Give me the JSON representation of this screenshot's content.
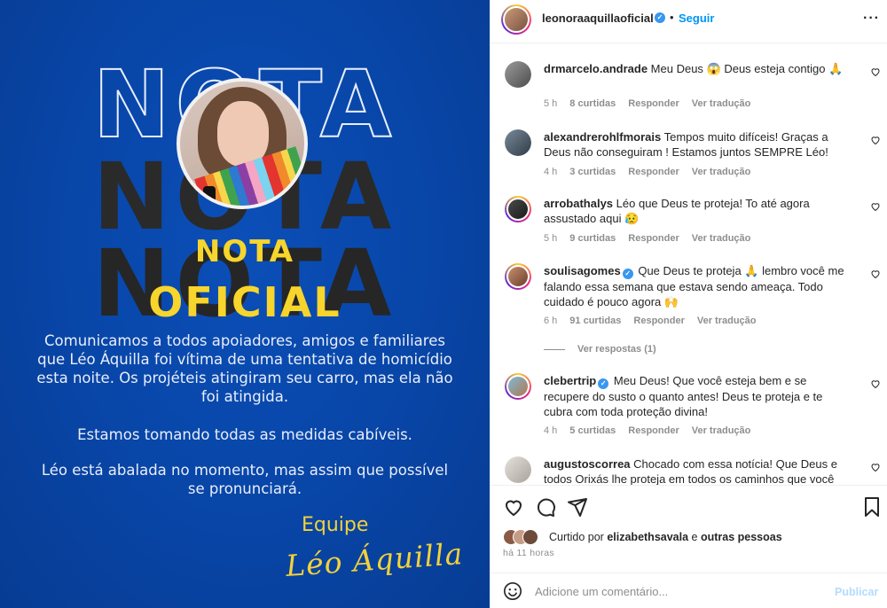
{
  "post_image": {
    "bg_word": "NOTA",
    "title_line1": "NOTA",
    "title_line2": "OFICIAL",
    "statement_1": "Comunicamos a todos apoiadores, amigos e familiares que Léo Áquilla foi vítima de uma tentativa de homicídio esta noite. Os projéteis atingiram seu carro, mas ela não foi atingida.",
    "statement_2": "Estamos tomando todas as medidas cabíveis.",
    "statement_3": "Léo está abalada no momento, mas assim que possível se pronunciará.",
    "team_label": "Equipe",
    "signature": "Léo Áquilla"
  },
  "header": {
    "username": "leonoraaquillaoficial",
    "separator": "•",
    "follow_label": "Seguir",
    "more_label": "···"
  },
  "comments": [
    {
      "user": "drmarcelo.andrade",
      "text": "Meu Deus 😱 Deus esteja contigo 🙏",
      "time": "5 h",
      "likes": "8 curtidas",
      "reply": "Responder",
      "translate": "Ver tradução",
      "verified": false
    },
    {
      "user": "alexandrerohlfmorais",
      "text": "Tempos muito difíceis! Graças a Deus não conseguiram ! Estamos juntos SEMPRE Léo!",
      "time": "4 h",
      "likes": "3 curtidas",
      "reply": "Responder",
      "translate": "Ver tradução",
      "verified": false
    },
    {
      "user": "arrobathalys",
      "text": "Léo que Deus te proteja! To até agora assustado aqui 😥",
      "time": "5 h",
      "likes": "9 curtidas",
      "reply": "Responder",
      "translate": "Ver tradução",
      "verified": false
    },
    {
      "user": "soulisagomes",
      "text": "Que Deus te proteja 🙏 lembro você me falando essa semana que estava sendo ameaça. Todo cuidado é pouco agora 🙌",
      "time": "6 h",
      "likes": "91 curtidas",
      "reply": "Responder",
      "translate": "Ver tradução",
      "verified": true
    },
    {
      "user": "clebertrip",
      "text": "Meu Deus! Que você esteja bem e se recupere do susto o quanto antes! Deus te proteja e te cubra com toda proteção divina!",
      "time": "4 h",
      "likes": "5 curtidas",
      "reply": "Responder",
      "translate": "Ver tradução",
      "verified": true
    },
    {
      "user": "augustoscorrea",
      "text": "Chocado com essa notícia! Que Deus e todos Orixás lhe proteja em todos os caminhos que você",
      "verified": false
    }
  ],
  "view_replies_label": "Ver respostas (1)",
  "likes_summary": {
    "prefix": "Curtido por",
    "user": "elizabethsavala",
    "connector": "e",
    "others": "outras pessoas"
  },
  "time_ago": "há 11 horas",
  "add_comment": {
    "placeholder": "Adicione um comentário...",
    "publish_label": "Publicar"
  },
  "icons": [
    "heart-icon",
    "comment-icon",
    "share-icon",
    "bookmark-icon",
    "emoji-icon",
    "verified-icon",
    "more-icon"
  ],
  "colors": {
    "post_bg": "#0845a6",
    "accent_yellow": "#f7d52c",
    "link_blue": "#0095f6",
    "verified_blue": "#3897f0",
    "muted_gray": "#8e8e8e"
  }
}
